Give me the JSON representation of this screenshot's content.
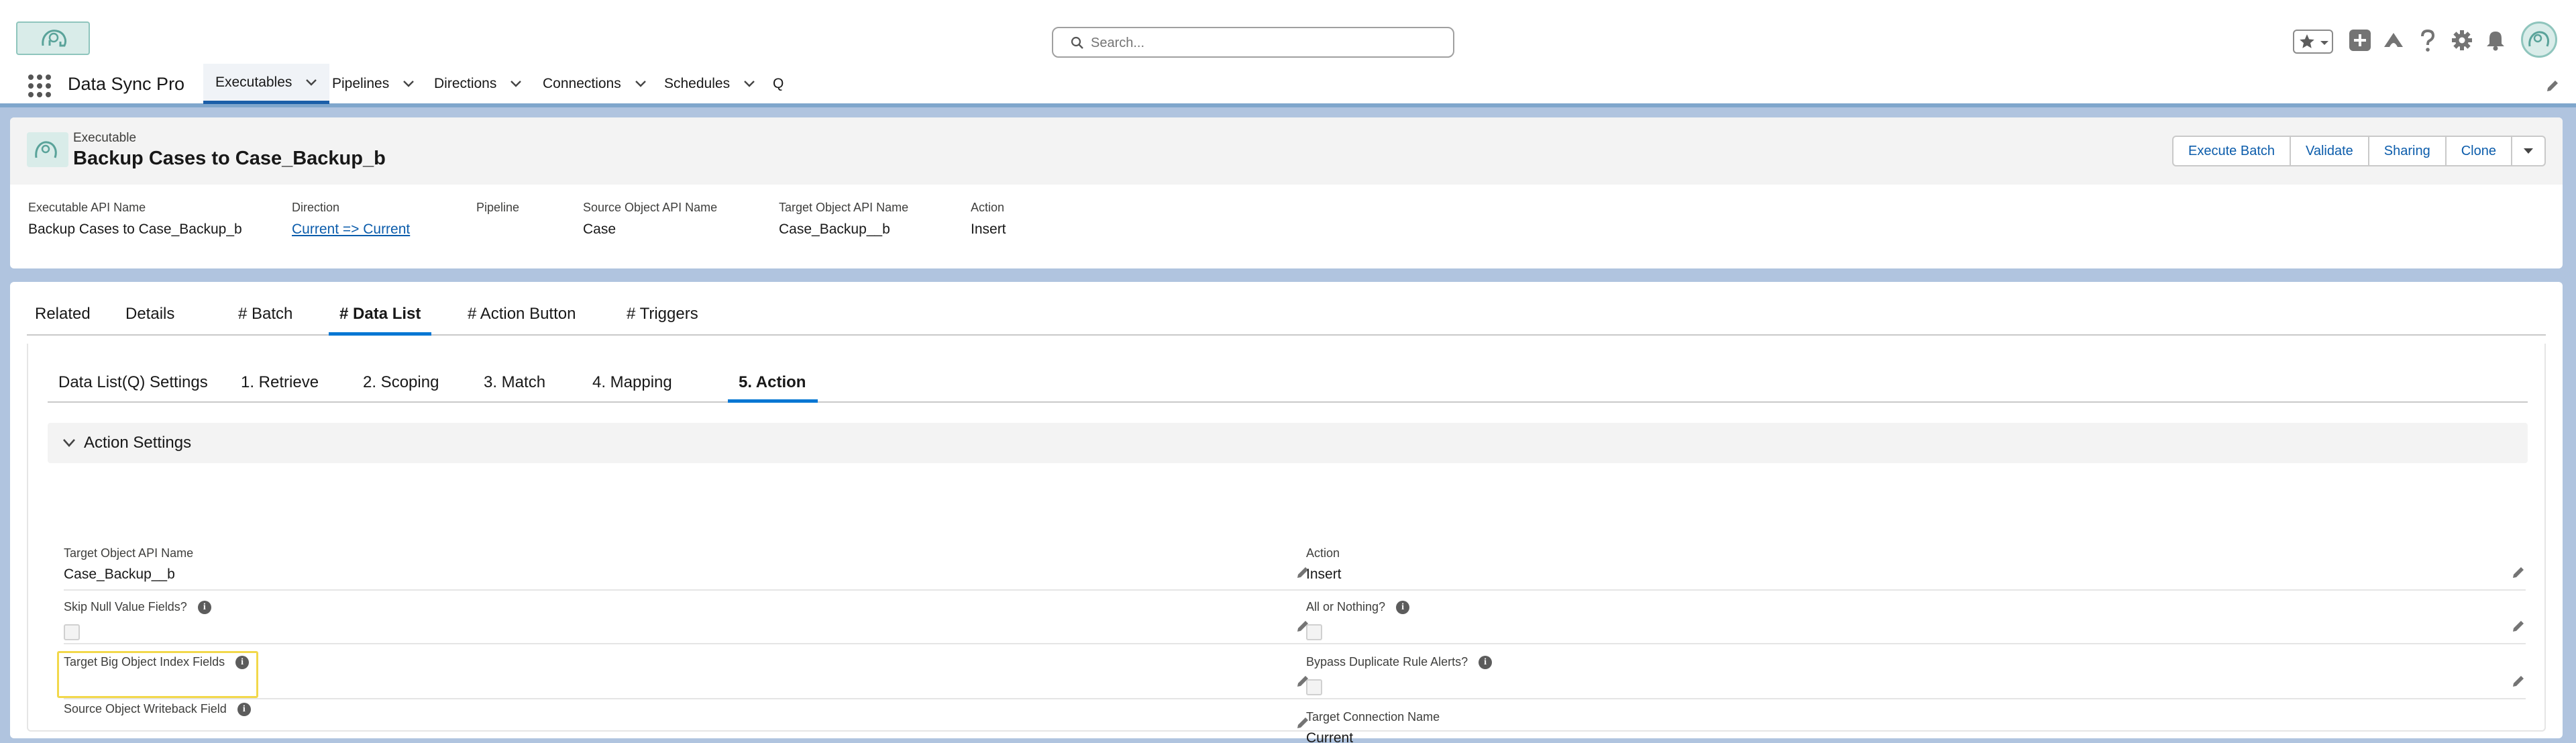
{
  "global_header": {
    "search_placeholder": "Search...",
    "icons": [
      "star-icon",
      "chevron-down-icon",
      "add-icon",
      "trailhead-icon",
      "help-icon",
      "setup-gear-icon",
      "notification-bell-icon",
      "user-avatar"
    ]
  },
  "nav": {
    "app_name": "Data Sync Pro",
    "items": [
      {
        "label": "Executables",
        "has_menu": true,
        "active": true
      },
      {
        "label": "Pipelines",
        "has_menu": true
      },
      {
        "label": "Directions",
        "has_menu": true
      },
      {
        "label": "Connections",
        "has_menu": true
      },
      {
        "label": "Schedules",
        "has_menu": true
      },
      {
        "label": "Q",
        "has_menu": false
      }
    ]
  },
  "record": {
    "object_label": "Executable",
    "title": "Backup Cases to Case_Backup_b",
    "actions": [
      "Execute Batch",
      "Validate",
      "Sharing",
      "Clone"
    ],
    "highlights": [
      {
        "label": "Executable API Name",
        "value": "Backup Cases to Case_Backup_b"
      },
      {
        "label": "Direction",
        "value": "Current => Current",
        "link": true
      },
      {
        "label": "Pipeline",
        "value": ""
      },
      {
        "label": "Source Object API Name",
        "value": "Case"
      },
      {
        "label": "Target Object API Name",
        "value": "Case_Backup__b"
      },
      {
        "label": "Action",
        "value": "Insert"
      }
    ]
  },
  "tabs": [
    {
      "label": "Related"
    },
    {
      "label": "Details"
    },
    {
      "label": "# Batch"
    },
    {
      "label": "# Data List",
      "active": true
    },
    {
      "label": "# Action Button"
    },
    {
      "label": "# Triggers"
    }
  ],
  "sub_tabs": [
    {
      "label": "Data List(Q) Settings"
    },
    {
      "label": "1. Retrieve"
    },
    {
      "label": "2. Scoping"
    },
    {
      "label": "3. Match"
    },
    {
      "label": "4. Mapping"
    },
    {
      "label": "5. Action",
      "active": true
    }
  ],
  "section": {
    "title": "Action Settings",
    "left_fields": [
      {
        "label": "Target Object API Name",
        "value": "Case_Backup__b",
        "type": "text"
      },
      {
        "label": "Skip Null Value Fields?",
        "type": "checkbox",
        "checked": false,
        "info": true
      },
      {
        "label": "Target Big Object Index Fields",
        "value": "",
        "type": "text",
        "info": true,
        "highlighted": true
      },
      {
        "label": "Source Object Writeback Field",
        "value": "",
        "type": "text",
        "info": true
      }
    ],
    "right_fields": [
      {
        "label": "Action",
        "value": "Insert",
        "type": "text"
      },
      {
        "label": "All or Nothing?",
        "type": "checkbox",
        "checked": false,
        "info": true
      },
      {
        "label": "Bypass Duplicate Rule Alerts?",
        "type": "checkbox",
        "checked": false,
        "info": true
      },
      {
        "label": "Target Connection Name",
        "value": "Current",
        "type": "text"
      }
    ]
  },
  "colors": {
    "brand_blue": "#0176d3",
    "link_blue": "#0b5cab",
    "page_background": "#b0c4df",
    "highlight_outline": "#f2d84b"
  }
}
